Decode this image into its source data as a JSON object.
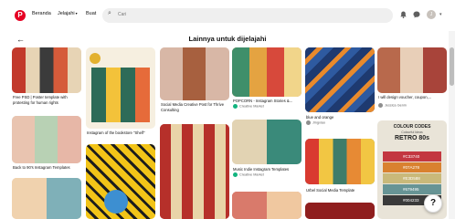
{
  "nav": {
    "home": "Beranda",
    "explore": "Jelajahi",
    "create": "Buat",
    "dropdown_glyph": "▾"
  },
  "search": {
    "placeholder": "Cari"
  },
  "page": {
    "heading": "Lainnya untuk dijelajahi"
  },
  "pins": [
    {
      "caption": "Free PSD | Poster template with protesting for human rights"
    },
    {
      "caption": "Back to 90's Instagram Templates"
    },
    {
      "caption": "Instagram of the bookstore \"Shelf\""
    },
    {
      "caption": "Social Media Creative Post for Thrive Consulting"
    },
    {
      "caption": "POPCORN - Instagram Stories &...",
      "source": "Creative Market"
    },
    {
      "caption": "Music Indie Instagram Templates",
      "source": "Creative Market"
    },
    {
      "caption": "blue and orange",
      "source": "Jingxiao"
    },
    {
      "caption": "Urbel Social Media Template"
    },
    {
      "caption": "I will design voucher, coupon,...",
      "source": "Jessica Genin"
    }
  ],
  "color_codes": {
    "title": "COLOUR CODES",
    "subtitle": "Colourful Ideas",
    "heading": "RETRO 80s",
    "swatches": [
      {
        "code": "#C33740",
        "color": "#c33740"
      },
      {
        "code": "#07A278",
        "color": "#d9812f"
      },
      {
        "code": "#E3D588",
        "color": "#c9b97a"
      },
      {
        "code": "#679495",
        "color": "#679495"
      },
      {
        "code": "#004233",
        "color": "#3a3a3a"
      }
    ]
  },
  "help_label": "?",
  "colors": {
    "brand": "#e60023",
    "verified": "#12b47f"
  }
}
